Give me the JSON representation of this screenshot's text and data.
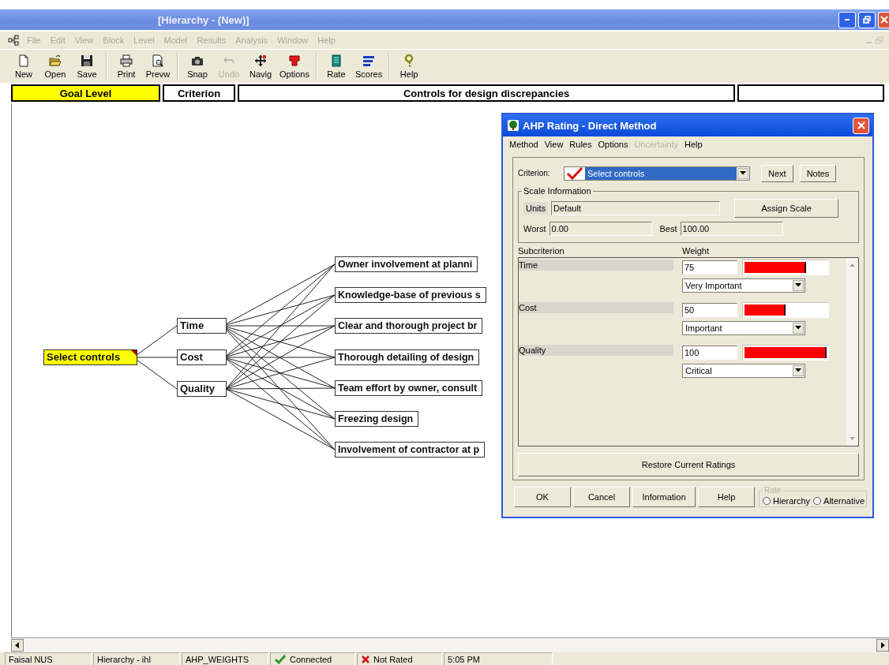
{
  "window": {
    "title": "[Hierarchy - (New)]"
  },
  "menu": [
    {
      "label": "File",
      "disabled": true
    },
    {
      "label": "Edit",
      "disabled": true
    },
    {
      "label": "View",
      "disabled": true
    },
    {
      "label": "Block",
      "disabled": true
    },
    {
      "label": "Level",
      "disabled": true
    },
    {
      "label": "Model",
      "disabled": true
    },
    {
      "label": "Results",
      "disabled": true
    },
    {
      "label": "Analysis",
      "disabled": true
    },
    {
      "label": "Window",
      "disabled": true
    },
    {
      "label": "Help",
      "disabled": true
    }
  ],
  "toolbar": [
    [
      {
        "label": "New",
        "kind": "new",
        "disabled": false
      },
      {
        "label": "Open",
        "kind": "open",
        "disabled": false
      },
      {
        "label": "Save",
        "kind": "save",
        "disabled": false
      }
    ],
    [
      {
        "label": "Print",
        "kind": "print",
        "disabled": false
      },
      {
        "label": "Prevw",
        "kind": "preview",
        "disabled": false
      }
    ],
    [
      {
        "label": "Snap",
        "kind": "snap",
        "disabled": false
      },
      {
        "label": "Undo",
        "kind": "undo",
        "disabled": true
      },
      {
        "label": "Navig",
        "kind": "navig",
        "disabled": false
      },
      {
        "label": "Options",
        "kind": "options",
        "disabled": false
      }
    ],
    [
      {
        "label": "Rate",
        "kind": "rate",
        "disabled": false
      },
      {
        "label": "Scores",
        "kind": "scores",
        "disabled": false
      }
    ],
    [
      {
        "label": "Help",
        "kind": "help",
        "disabled": false
      }
    ]
  ],
  "level_bar": [
    {
      "label": "Goal Level",
      "selected": true
    },
    {
      "label": "Criterion",
      "selected": false
    },
    {
      "label": "Controls for design discrepancies",
      "selected": false
    }
  ],
  "hierarchy": {
    "goal": {
      "label": "Select controls",
      "selected": true,
      "marked": true
    },
    "criteria": [
      {
        "label": "Time",
        "selected": false
      },
      {
        "label": "Cost",
        "selected": false
      },
      {
        "label": "Quality",
        "selected": false
      }
    ],
    "alternatives": [
      {
        "label": "Owner involvement at planni"
      },
      {
        "label": "Knowledge-base of previous s"
      },
      {
        "label": "Clear and thorough project br"
      },
      {
        "label": "Thorough detailing of design"
      },
      {
        "label": "Team effort by owner, consult"
      },
      {
        "label": "Freezing design"
      },
      {
        "label": "Involvement of contractor at p"
      }
    ]
  },
  "dialog": {
    "title": "AHP Rating - Direct Method",
    "menu": [
      {
        "label": "Method",
        "disabled": false
      },
      {
        "label": "View",
        "disabled": false
      },
      {
        "label": "Rules",
        "disabled": false
      },
      {
        "label": "Options",
        "disabled": false
      },
      {
        "label": "Uncertainty",
        "disabled": true
      },
      {
        "label": "Help",
        "disabled": false
      }
    ],
    "criterion_label": "Criterion:",
    "criterion_value": "Select controls",
    "next_button": "Next",
    "notes_button": "Notes",
    "scale_group": "Scale Information",
    "units_label": "Units",
    "units_value": "Default",
    "assign_button": "Assign Scale",
    "worst_label": "Worst",
    "worst_value": "0.00",
    "best_label": "Best",
    "best_value": "100.00",
    "columns": [
      "Subcriterion",
      "Weight"
    ],
    "ratings": [
      {
        "name": "Time",
        "weight": "75",
        "level": 0.75,
        "intensity": "Very Important"
      },
      {
        "name": "Cost",
        "weight": "50",
        "level": 0.5,
        "intensity": "Important"
      },
      {
        "name": "Quality",
        "weight": "100",
        "level": 1,
        "intensity": "Critical"
      }
    ],
    "restore_button": "Restore Current Ratings",
    "buttons": [
      "OK",
      "Cancel",
      "Information",
      "Help"
    ],
    "rate_group": "Rate",
    "rate_options": [
      {
        "label": "Hierarchy",
        "selected": false
      },
      {
        "label": "Alternative",
        "selected": false
      }
    ]
  },
  "status_bar": [
    {
      "text": "Faisal NUS",
      "kind": "plain"
    },
    {
      "text": "Hierarchy - ihl",
      "kind": "plain"
    },
    {
      "text": "AHP_WEIGHTS",
      "kind": "plain"
    },
    {
      "text": "Connected",
      "kind": "check"
    },
    {
      "text": "Not Rated",
      "kind": "cross"
    },
    {
      "text": "5:05 PM",
      "kind": "plain"
    }
  ]
}
